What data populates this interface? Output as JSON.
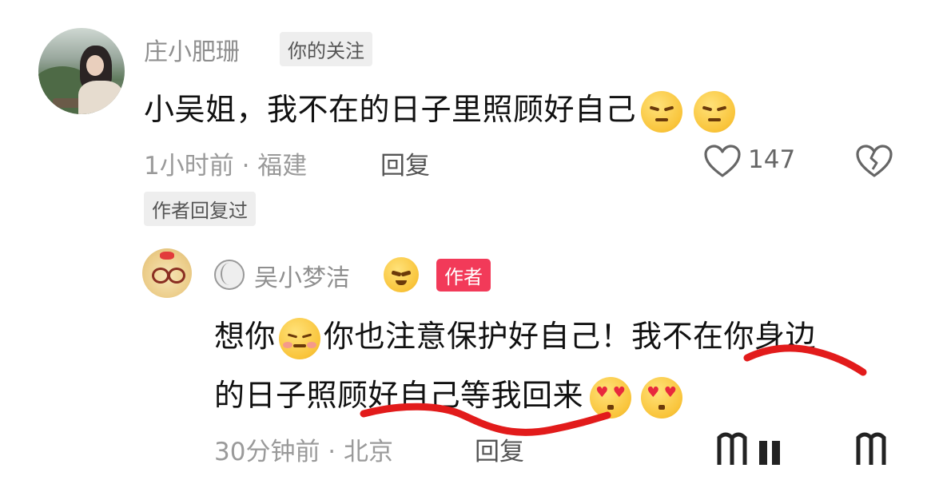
{
  "comment": {
    "author": "庄小肥珊",
    "follow_tag": "你的关注",
    "text": "小吴姐，我不在的日子里照顾好自己",
    "time_location": "1小时前 · 福建",
    "reply_label": "回复",
    "like_count": "147",
    "author_replied_tag": "作者回复过"
  },
  "reply": {
    "author": "吴小梦洁",
    "author_tag": "作者",
    "line1": "想你",
    "line1b": "你也注意保护好自己！我不在你身边",
    "line2": "的日子照顾好自己等我回来",
    "time_location": "30分钟前 · 北京",
    "reply_label": "回复"
  },
  "colors": {
    "author_tag_bg": "#f23a59",
    "underline": "#e21b1b"
  },
  "icons": [
    "heart-outline-icon",
    "broken-heart-icon",
    "volleyball-icon",
    "yum-emoji",
    "smiling-hearts-emoji",
    "heart-eyes-emoji",
    "unamused-emoji"
  ]
}
